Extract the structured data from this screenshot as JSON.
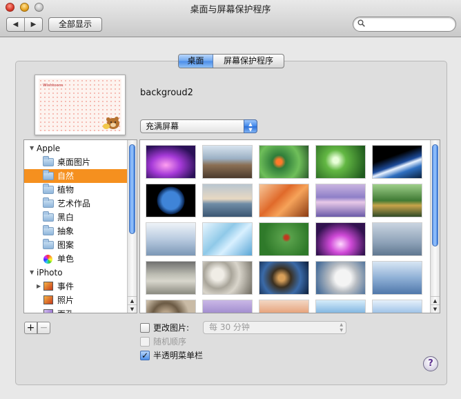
{
  "window": {
    "title": "桌面与屏幕保护程序"
  },
  "toolbar": {
    "back_glyph": "◀",
    "forward_glyph": "▶",
    "show_all_label": "全部显示",
    "search_placeholder": "",
    "search_value": ""
  },
  "tabs": [
    {
      "label": "桌面",
      "selected": true
    },
    {
      "label": "屏幕保护程序",
      "selected": false
    }
  ],
  "preview": {
    "picture_name": "backgroud2",
    "logo_text": "Wishtoons"
  },
  "fit_popup": {
    "value": "充满屏幕"
  },
  "source_list": {
    "groups": [
      {
        "label": "Apple",
        "items": [
          {
            "label": "桌面图片",
            "icon": "folder-icon",
            "selected": false
          },
          {
            "label": "自然",
            "icon": "folder-icon",
            "selected": true
          },
          {
            "label": "植物",
            "icon": "folder-icon",
            "selected": false
          },
          {
            "label": "艺术作品",
            "icon": "folder-icon",
            "selected": false
          },
          {
            "label": "黑白",
            "icon": "folder-icon",
            "selected": false
          },
          {
            "label": "抽象",
            "icon": "folder-icon",
            "selected": false
          },
          {
            "label": "图案",
            "icon": "folder-icon",
            "selected": false
          },
          {
            "label": "单色",
            "icon": "color-wheel-icon",
            "selected": false
          }
        ]
      },
      {
        "label": "iPhoto",
        "items": [
          {
            "label": "事件",
            "icon": "iphoto-events-icon",
            "selected": false
          },
          {
            "label": "照片",
            "icon": "iphoto-photos-icon",
            "selected": false
          },
          {
            "label": "面孔",
            "icon": "iphoto-faces-icon",
            "selected": false
          }
        ]
      }
    ]
  },
  "thumbnails": [
    "purple aurora",
    "mountain peaks",
    "clownfish anemone",
    "green dewdrop",
    "earth horizon",
    "blue earth",
    "misty lake",
    "orange sandstone",
    "purple waves",
    "pagoda garden",
    "calm sea",
    "ice crystals",
    "ladybug leaf",
    "pink aurora",
    "reeds water",
    "zen garden",
    "pebbles",
    "leopard rocks",
    "snow leopard",
    "blue waves",
    "stones shore",
    "purple sky",
    "sunset sea",
    "blue water",
    "ocean horizon"
  ],
  "options": {
    "change_picture_label": "更改图片:",
    "change_picture_checked": false,
    "interval_value": "每 30 分钟",
    "random_order_label": "随机顺序",
    "random_order_checked": false,
    "translucent_menubar_label": "半透明菜单栏",
    "translucent_menubar_checked": true
  },
  "buttons": {
    "add_label": "+",
    "remove_label": "−",
    "help_label": "?"
  },
  "colors": {
    "selection": "#f5901f",
    "accent_blue": "#3e86ea"
  }
}
